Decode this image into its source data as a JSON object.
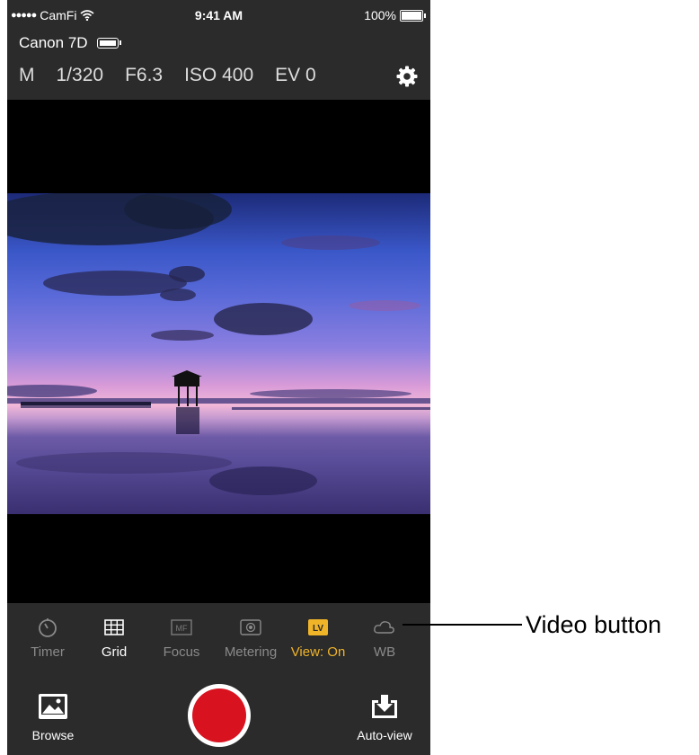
{
  "status_bar": {
    "carrier": "CamFi",
    "signal_dots": "●●●●●",
    "time": "9:41 AM",
    "battery": "100%"
  },
  "camera": {
    "name": "Canon 7D"
  },
  "exposure": {
    "mode": "M",
    "shutter": "1/320",
    "aperture": "F6.3",
    "iso": "ISO 400",
    "ev": "EV 0"
  },
  "toolbar": {
    "items": [
      {
        "label": "Timer",
        "icon": "timer-icon",
        "state": "normal"
      },
      {
        "label": "Grid",
        "icon": "grid-icon",
        "state": "active"
      },
      {
        "label": "Focus",
        "icon": "mf-icon",
        "icon_text": "MF",
        "state": "normal"
      },
      {
        "label": "Metering",
        "icon": "metering-icon",
        "state": "normal"
      },
      {
        "label": "View: On",
        "icon": "lv-icon",
        "icon_text": "LV",
        "state": "on"
      },
      {
        "label": "WB",
        "icon": "cloud-icon",
        "state": "normal"
      }
    ]
  },
  "bottom": {
    "browse_label": "Browse",
    "autoview_label": "Auto-view"
  },
  "callout": {
    "text": "Video button"
  },
  "colors": {
    "accent": "#f0b429",
    "shutter_red": "#d8121f",
    "panel": "#2b2b2b"
  }
}
